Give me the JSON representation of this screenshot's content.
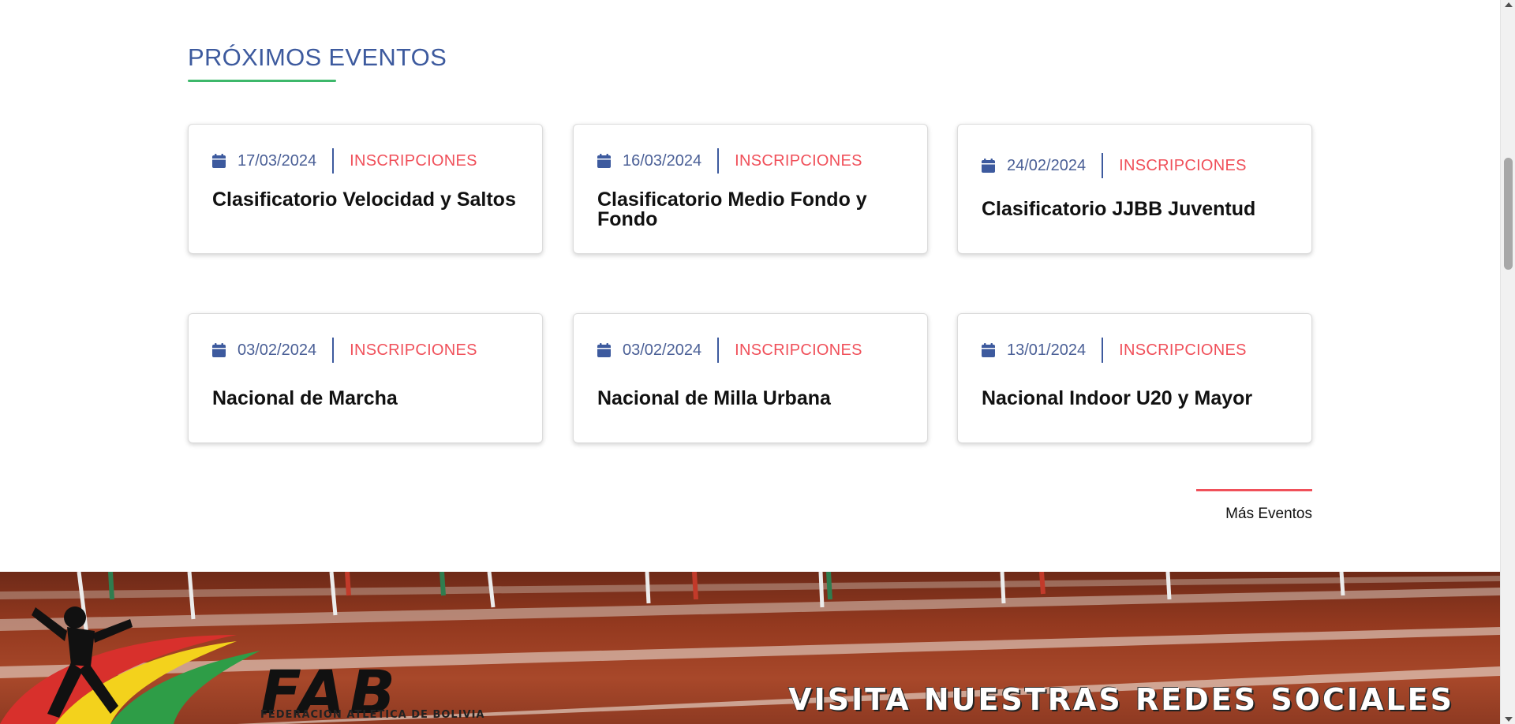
{
  "section": {
    "title": "PRÓXIMOS EVENTOS"
  },
  "events": [
    {
      "date": "17/03/2024",
      "category": "INSCRIPCIONES",
      "title": "Clasificatorio Velocidad y Saltos"
    },
    {
      "date": "16/03/2024",
      "category": "INSCRIPCIONES",
      "title": "Clasificatorio Medio Fondo y Fondo"
    },
    {
      "date": "24/02/2024",
      "category": "INSCRIPCIONES",
      "title": "Clasificatorio JJBB Juventud"
    },
    {
      "date": "03/02/2024",
      "category": "INSCRIPCIONES",
      "title": "Nacional de Marcha"
    },
    {
      "date": "03/02/2024",
      "category": "INSCRIPCIONES",
      "title": "Nacional de Milla Urbana"
    },
    {
      "date": "13/01/2024",
      "category": "INSCRIPCIONES",
      "title": "Nacional Indoor U20 y Mayor"
    }
  ],
  "more_events": {
    "label": "Más Eventos"
  },
  "banner": {
    "text": "VISITA NUESTRAS REDES SOCIALES",
    "logo_text": "FAB",
    "logo_subtext": "FEDERACION ATLETICA DE BOLIVIA"
  },
  "icons": {
    "date_icon": "calendar-icon"
  },
  "colors": {
    "title_blue": "#3d5a9e",
    "accent_green": "#3db86b",
    "accent_red": "#f0505a",
    "date_text": "#4a5f96"
  }
}
